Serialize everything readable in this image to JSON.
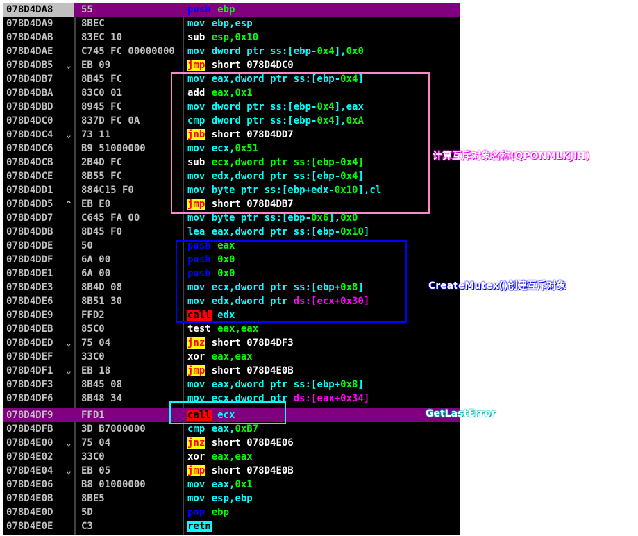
{
  "colors": {
    "background": "#000000",
    "selection": "#800080",
    "address_fg": "#c0c0c0",
    "mov": "#00ffff",
    "push_pop": "#0000ff",
    "jump_bg": "#ffff00",
    "jump_fg": "#ff0000",
    "call_bg": "#ff0000",
    "retn_bg": "#00ffff",
    "immediate": "#00ff00",
    "segment_ref": "#ff00ff",
    "pink_box": "#ff88cc",
    "blue_box": "#0000ff",
    "cyan_box": "#00ffff"
  },
  "rows": [
    {
      "addr": "078D4DA8",
      "mark": "",
      "hex": "55",
      "mn": "push",
      "ops": "ebp",
      "kind": "push",
      "current": true
    },
    {
      "addr": "078D4DA9",
      "mark": "",
      "hex": "8BEC",
      "mn": "mov",
      "ops": "ebp,esp",
      "kind": "mov"
    },
    {
      "addr": "078D4DAB",
      "mark": "",
      "hex": "83EC 10",
      "mn": "sub",
      "ops": "esp,0x10",
      "kind": "sub"
    },
    {
      "addr": "078D4DAE",
      "mark": "",
      "hex": "C745 FC 00000000",
      "mn": "mov",
      "ops": "dword ptr ss:[ebp-0x4],0x0",
      "kind": "mov"
    },
    {
      "addr": "078D4DB5",
      "mark": "⌄",
      "hex": "EB 09",
      "mn": "jmp",
      "ops": "short 078D4DC0",
      "kind": "jmp"
    },
    {
      "addr": "078D4DB7",
      "mark": "",
      "hex": "8B45 FC",
      "mn": "mov",
      "ops": "eax,dword ptr ss:[ebp-0x4]",
      "kind": "mov"
    },
    {
      "addr": "078D4DBA",
      "mark": "",
      "hex": "83C0 01",
      "mn": "add",
      "ops": "eax,0x1",
      "kind": "sub"
    },
    {
      "addr": "078D4DBD",
      "mark": "",
      "hex": "8945 FC",
      "mn": "mov",
      "ops": "dword ptr ss:[ebp-0x4],eax",
      "kind": "mov"
    },
    {
      "addr": "078D4DC0",
      "mark": "",
      "hex": "837D FC 0A",
      "mn": "cmp",
      "ops": "dword ptr ss:[ebp-0x4],0xA",
      "kind": "mov"
    },
    {
      "addr": "078D4DC4",
      "mark": "⌄",
      "hex": "73 11",
      "mn": "jnb",
      "ops": "short 078D4DD7",
      "kind": "jmp"
    },
    {
      "addr": "078D4DC6",
      "mark": "",
      "hex": "B9 51000000",
      "mn": "mov",
      "ops": "ecx,0x51",
      "kind": "mov"
    },
    {
      "addr": "078D4DCB",
      "mark": "",
      "hex": "2B4D FC",
      "mn": "sub",
      "ops": "ecx,dword ptr ss:[ebp-0x4]",
      "kind": "sub"
    },
    {
      "addr": "078D4DCE",
      "mark": "",
      "hex": "8B55 FC",
      "mn": "mov",
      "ops": "edx,dword ptr ss:[ebp-0x4]",
      "kind": "mov"
    },
    {
      "addr": "078D4DD1",
      "mark": "",
      "hex": "884C15 F0",
      "mn": "mov",
      "ops": "byte ptr ss:[ebp+edx-0x10],cl",
      "kind": "mov"
    },
    {
      "addr": "078D4DD5",
      "mark": "^",
      "hex": "EB E0",
      "mn": "jmp",
      "ops": "short 078D4DB7",
      "kind": "jmp"
    },
    {
      "addr": "078D4DD7",
      "mark": "",
      "hex": "C645 FA 00",
      "mn": "mov",
      "ops": "byte ptr ss:[ebp-0x6],0x0",
      "kind": "mov"
    },
    {
      "addr": "078D4DDB",
      "mark": "",
      "hex": "8D45 F0",
      "mn": "lea",
      "ops": "eax,dword ptr ss:[ebp-0x10]",
      "kind": "mov"
    },
    {
      "addr": "078D4DDE",
      "mark": "",
      "hex": "50",
      "mn": "push",
      "ops": "eax",
      "kind": "push"
    },
    {
      "addr": "078D4DDF",
      "mark": "",
      "hex": "6A 00",
      "mn": "push",
      "ops": "0x0",
      "kind": "push"
    },
    {
      "addr": "078D4DE1",
      "mark": "",
      "hex": "6A 00",
      "mn": "push",
      "ops": "0x0",
      "kind": "push"
    },
    {
      "addr": "078D4DE3",
      "mark": "",
      "hex": "8B4D 08",
      "mn": "mov",
      "ops": "ecx,dword ptr ss:[ebp+0x8]",
      "kind": "mov"
    },
    {
      "addr": "078D4DE6",
      "mark": "",
      "hex": "8B51 30",
      "mn": "mov",
      "ops": "edx,dword ptr ds:[ecx+0x30]",
      "kind": "mov"
    },
    {
      "addr": "078D4DE9",
      "mark": "",
      "hex": "FFD2",
      "mn": "call",
      "ops": "edx",
      "kind": "call"
    },
    {
      "addr": "078D4DEB",
      "mark": "",
      "hex": "85C0",
      "mn": "test",
      "ops": "eax,eax",
      "kind": "sub"
    },
    {
      "addr": "078D4DED",
      "mark": "⌄",
      "hex": "75 04",
      "mn": "jnz",
      "ops": "short 078D4DF3",
      "kind": "jmp"
    },
    {
      "addr": "078D4DEF",
      "mark": "",
      "hex": "33C0",
      "mn": "xor",
      "ops": "eax,eax",
      "kind": "sub"
    },
    {
      "addr": "078D4DF1",
      "mark": "⌄",
      "hex": "EB 18",
      "mn": "jmp",
      "ops": "short 078D4E0B",
      "kind": "jmp"
    },
    {
      "addr": "078D4DF3",
      "mark": "",
      "hex": "8B45 08",
      "mn": "mov",
      "ops": "eax,dword ptr ss:[ebp+0x8]",
      "kind": "mov"
    },
    {
      "addr": "078D4DF6",
      "mark": "",
      "hex": "8B48 34",
      "mn": "mov",
      "ops": "ecx,dword ptr ds:[eax+0x34]",
      "kind": "mov"
    },
    {
      "addr": "078D4DF9",
      "mark": "",
      "hex": "FFD1",
      "mn": "call",
      "ops": "ecx",
      "kind": "call",
      "selected": true
    },
    {
      "addr": "078D4DFB",
      "mark": "",
      "hex": "3D B7000000",
      "mn": "cmp",
      "ops": "eax,0xB7",
      "kind": "mov"
    },
    {
      "addr": "078D4E00",
      "mark": "⌄",
      "hex": "75 04",
      "mn": "jnz",
      "ops": "short 078D4E06",
      "kind": "jmp"
    },
    {
      "addr": "078D4E02",
      "mark": "",
      "hex": "33C0",
      "mn": "xor",
      "ops": "eax,eax",
      "kind": "sub"
    },
    {
      "addr": "078D4E04",
      "mark": "⌄",
      "hex": "EB 05",
      "mn": "jmp",
      "ops": "short 078D4E0B",
      "kind": "jmp"
    },
    {
      "addr": "078D4E06",
      "mark": "",
      "hex": "B8 01000000",
      "mn": "mov",
      "ops": "eax,0x1",
      "kind": "mov"
    },
    {
      "addr": "078D4E0B",
      "mark": "",
      "hex": "8BE5",
      "mn": "mov",
      "ops": "esp,ebp",
      "kind": "mov"
    },
    {
      "addr": "078D4E0D",
      "mark": "",
      "hex": "5D",
      "mn": "pop",
      "ops": "ebp",
      "kind": "push"
    },
    {
      "addr": "078D4E0E",
      "mark": "",
      "hex": "C3",
      "mn": "retn",
      "ops": "",
      "kind": "retn"
    }
  ],
  "annotations": {
    "mutex_name": "计算互斥对象名称(QPONMLKJIH)",
    "create_mutex": "CreateMutex()创建互斥对象",
    "get_last_error": "GetLastError"
  }
}
